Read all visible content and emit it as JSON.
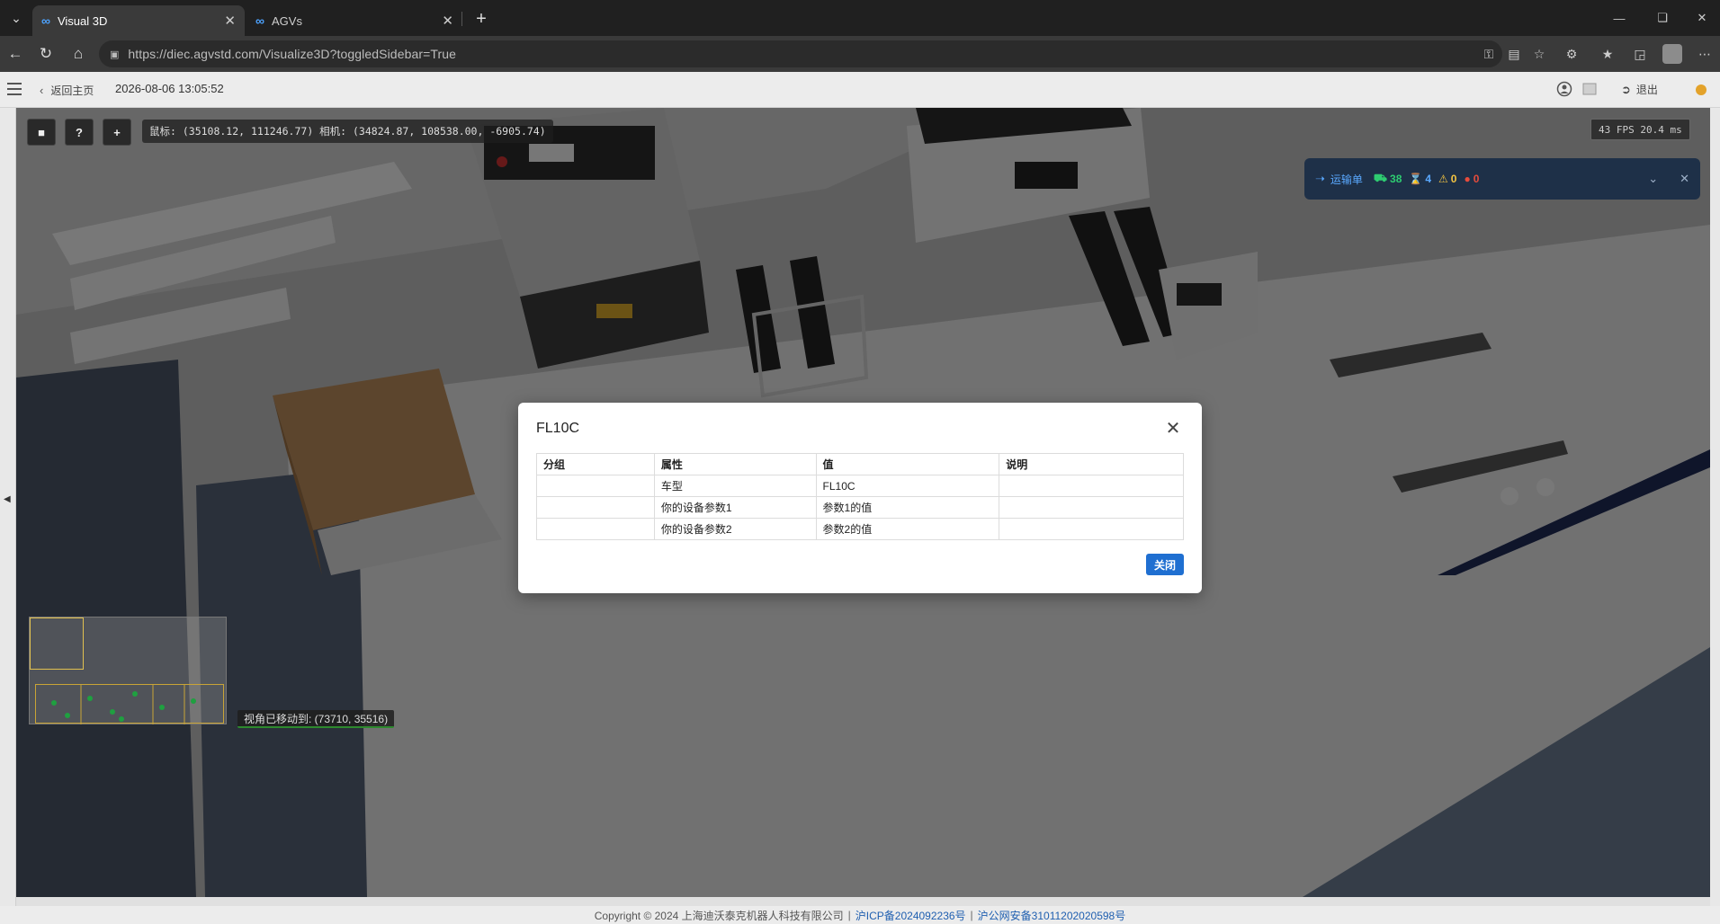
{
  "browser": {
    "tabs": [
      {
        "label": "Visual 3D",
        "active": true
      },
      {
        "label": "AGVs",
        "active": false
      }
    ],
    "url": "https://diec.agvstd.com/Visualize3D?toggledSidebar=True"
  },
  "header": {
    "back_label": "返回主页",
    "datetime": "2026-08-06 13:05:52",
    "logout_label": "退出"
  },
  "viewport": {
    "coord_readout": "鼠标: (35108.12, 111246.77)  相机: (34824.87, 108538.00, -6905.74)",
    "fps": "43 FPS 20.4 ms",
    "toolbar": {
      "help": "?",
      "add": "+"
    },
    "transport_panel": {
      "title": "运输单",
      "stat_vehicles": "38",
      "stat_waiting": "4",
      "stat_warning": "0",
      "stat_error": "0",
      "colors": {
        "vehicles": "#2ecc71",
        "waiting": "#5aa9ff",
        "warning": "#f5c542",
        "error": "#e74c3c"
      }
    },
    "toast": "视角已移动到: (73710, 35516)"
  },
  "modal": {
    "title": "FL10C",
    "columns": [
      "分组",
      "属性",
      "值",
      "说明"
    ],
    "rows": [
      [
        "",
        "车型",
        "FL10C",
        ""
      ],
      [
        "",
        "你的设备参数1",
        "参数1的值",
        ""
      ],
      [
        "",
        "你的设备参数2",
        "参数2的值",
        ""
      ]
    ],
    "close_button": "关闭"
  },
  "footer": {
    "copyright": "Copyright © 2024 上海迪沃泰克机器人科技有限公司",
    "icp": "沪ICP备2024092236号",
    "police": "沪公网安备31011202020598号"
  },
  "colors": {
    "accent": "#1f6fd1",
    "link": "#1f5fb0",
    "status_dot": "#e3a22a"
  }
}
